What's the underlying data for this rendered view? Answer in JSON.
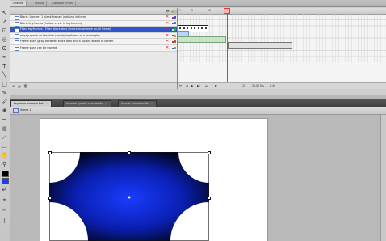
{
  "timeline_panel": {
    "tabs": [
      "Timeline",
      "Output",
      "Compiler Errors"
    ]
  },
  "layers": [
    {
      "name": "Blank: Convert 1 blank frames (nothing in them)",
      "selected": false,
      "color": "#6b3fd6"
    },
    {
      "name": "Blank keyframes (hollow circle in keyframes)",
      "selected": false,
      "color": "#3a7de0"
    },
    {
      "name": "Filled keyframes - Filled black dots (indicates artwork on/at frame)",
      "selected": true,
      "color": "#2aa34a"
    },
    {
      "name": "empty space on timeline (empty keyframe or a rectangle)",
      "selected": false,
      "color": "#e0a020"
    },
    {
      "name": "Frame span (gray between black dots and a square ahead of border",
      "selected": false,
      "color": "#d44"
    },
    {
      "name": "Frame span can be moved",
      "selected": false,
      "color": "#3fb8d6"
    }
  ],
  "frame_ruler": {
    "labels": [
      "1",
      "5",
      "10"
    ]
  },
  "playhead": {
    "frame": 10
  },
  "frame_footer": {
    "fps": "24.00 fps",
    "time": "0.4s"
  },
  "document_tabs": [
    {
      "label": "keyframe-example.fla*",
      "active": true
    },
    {
      "label": "tutorials-symbol-samples.fla",
      "active": false
    },
    {
      "label": "tutorial-animation.fla",
      "active": false
    }
  ],
  "edit_bar": {
    "scene": "Scene 1"
  },
  "stage": {
    "background": "#ffffff",
    "shape_fill_inner": "#1a3cff",
    "shape_fill_outer": "#000000"
  }
}
